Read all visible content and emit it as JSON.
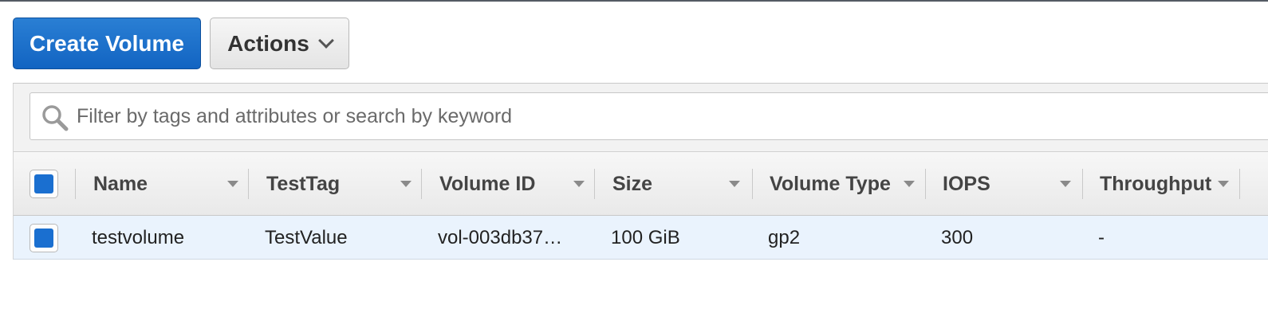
{
  "toolbar": {
    "create_label": "Create Volume",
    "actions_label": "Actions"
  },
  "search": {
    "placeholder": "Filter by tags and attributes or search by keyword"
  },
  "columns": [
    {
      "label": "Name"
    },
    {
      "label": "TestTag"
    },
    {
      "label": "Volume ID"
    },
    {
      "label": "Size"
    },
    {
      "label": "Volume Type"
    },
    {
      "label": "IOPS"
    },
    {
      "label": "Throughput"
    }
  ],
  "rows": [
    {
      "selected": true,
      "cells": [
        "testvolume",
        "TestValue",
        "vol-003db37…",
        "100 GiB",
        "gp2",
        "300",
        "-"
      ]
    }
  ],
  "colors": {
    "primary_button": "#1a6fd0",
    "selected_row": "#eaf3fd"
  }
}
